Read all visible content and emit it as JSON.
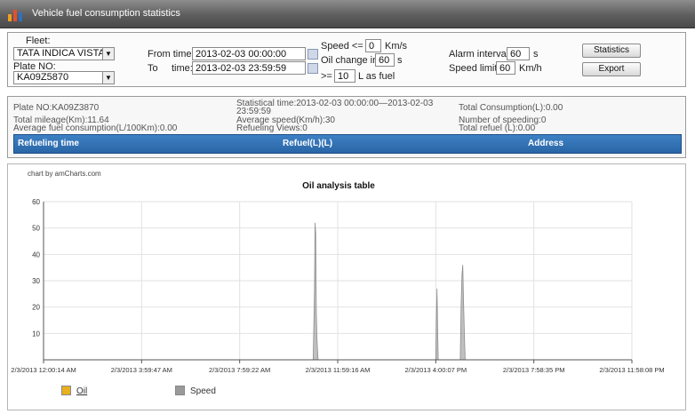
{
  "window": {
    "title": "Vehicle fuel consumption statistics"
  },
  "query": {
    "fleet_label": "Fleet:",
    "fleet_value": "TATA INDICA VISTA",
    "plate_label": "Plate NO:",
    "plate_value": "KA09Z5870",
    "from_label": "From time:",
    "from_value": "2013-02-03 00:00:00",
    "to_label": "To",
    "to_time_label": "time:",
    "to_value": "2013-02-03 23:59:59",
    "speed_label": "Speed <=",
    "speed_value": "0",
    "speed_unit": "Km/s",
    "oil_change_label": "Oil change in",
    "oil_change_value": "60",
    "oil_change_unit": "s",
    "fuel_prefix": ">=",
    "fuel_value": "10",
    "fuel_suffix": "L as fuel",
    "alarm_label": "Alarm interval",
    "alarm_value": "60",
    "alarm_unit": "s",
    "speed_limit_label": "Speed limit",
    "speed_limit_value": "60",
    "speed_limit_unit": "Km/h",
    "statistics_button": "Statistics",
    "export_button": "Export"
  },
  "summary": {
    "plate": "Plate NO:KA09Z3870",
    "total_mileage": "Total mileage(Km):11.64",
    "avg_fuel": "Average fuel consumption(L/100Km):0.00",
    "stat_time_1": "Statistical time:2013-02-03 00:00:00—2013-02-03",
    "stat_time_2": "23:59:59",
    "avg_speed": "Average speed(Km/h):30",
    "refueling_views": "Refueling Views:0",
    "total_consumption": "Total Consumption(L):0.00",
    "speeding": "Number of speeding:0",
    "total_refuel": "Total refuel (L):0.00"
  },
  "table": {
    "columns": [
      "Refueling time",
      "Refuel(L)(L)",
      "Address"
    ]
  },
  "chart_data": {
    "type": "area",
    "credit": "chart by amCharts.com",
    "title": "Oil analysis table",
    "ylim": [
      0,
      60
    ],
    "yticks": [
      10,
      20,
      30,
      40,
      50,
      60
    ],
    "xlim": [
      0,
      86400
    ],
    "x_tick_labels": [
      "2/3/2013 12:00:14 AM",
      "2/3/2013 3:59:47 AM",
      "2/3/2013 7:59:22 AM",
      "2/3/2013 11:59:16 AM",
      "2/3/2013 4:00:07 PM",
      "2/3/2013 7:58:35 PM",
      "2/3/2013 11:58:08 PM"
    ],
    "grid": true,
    "series": [
      {
        "name": "Oil",
        "values": [],
        "color": "#e8b020"
      },
      {
        "name": "Speed",
        "color": "#8c8c8c",
        "x": [
          39600,
          39780,
          39870,
          39960,
          40050,
          40140,
          40320,
          57600,
          57690,
          57780,
          57870,
          57960,
          61200,
          61320,
          61440,
          61560,
          61680,
          61800,
          61920
        ],
        "values": [
          0,
          26,
          52,
          48,
          18,
          8,
          0,
          0,
          15,
          27,
          12,
          0,
          0,
          20,
          32,
          36,
          22,
          10,
          0
        ]
      }
    ],
    "legend_position": "bottom-left"
  }
}
